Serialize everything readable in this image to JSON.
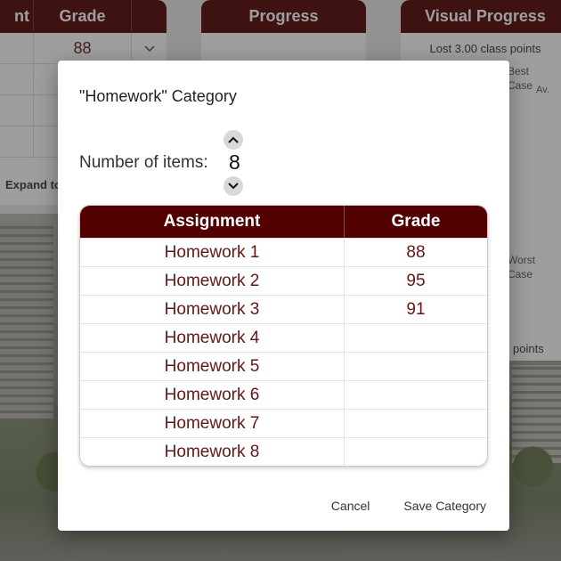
{
  "background_cards": {
    "left": {
      "header_partial": "nt",
      "header_grade": "Grade",
      "first_grade": "88",
      "expand_label": "Expand to"
    },
    "middle": {
      "header": "Progress"
    },
    "right": {
      "header": "Visual Progress",
      "lost_text": "Lost 3.00 class points",
      "best_label": "Best Case",
      "av_label": "Av.",
      "worst_label": "Worst Case",
      "points_text": "points"
    }
  },
  "modal": {
    "title": "\"Homework\" Category",
    "number_label": "Number of items:",
    "number_value": "8",
    "table": {
      "headers": [
        "Assignment",
        "Grade"
      ],
      "rows": [
        {
          "assignment": "Homework 1",
          "grade": "88"
        },
        {
          "assignment": "Homework 2",
          "grade": "95"
        },
        {
          "assignment": "Homework 3",
          "grade": "91"
        },
        {
          "assignment": "Homework 4",
          "grade": ""
        },
        {
          "assignment": "Homework 5",
          "grade": ""
        },
        {
          "assignment": "Homework 6",
          "grade": ""
        },
        {
          "assignment": "Homework 7",
          "grade": ""
        },
        {
          "assignment": "Homework 8",
          "grade": ""
        }
      ]
    },
    "cancel_label": "Cancel",
    "save_label": "Save Category"
  },
  "colors": {
    "header_bg": "#520000",
    "cell_text": "#6b1414"
  },
  "icons": {
    "spin_up": "chevron-up-icon",
    "spin_down": "chevron-down-icon",
    "dropdown": "chevron-down-icon"
  }
}
